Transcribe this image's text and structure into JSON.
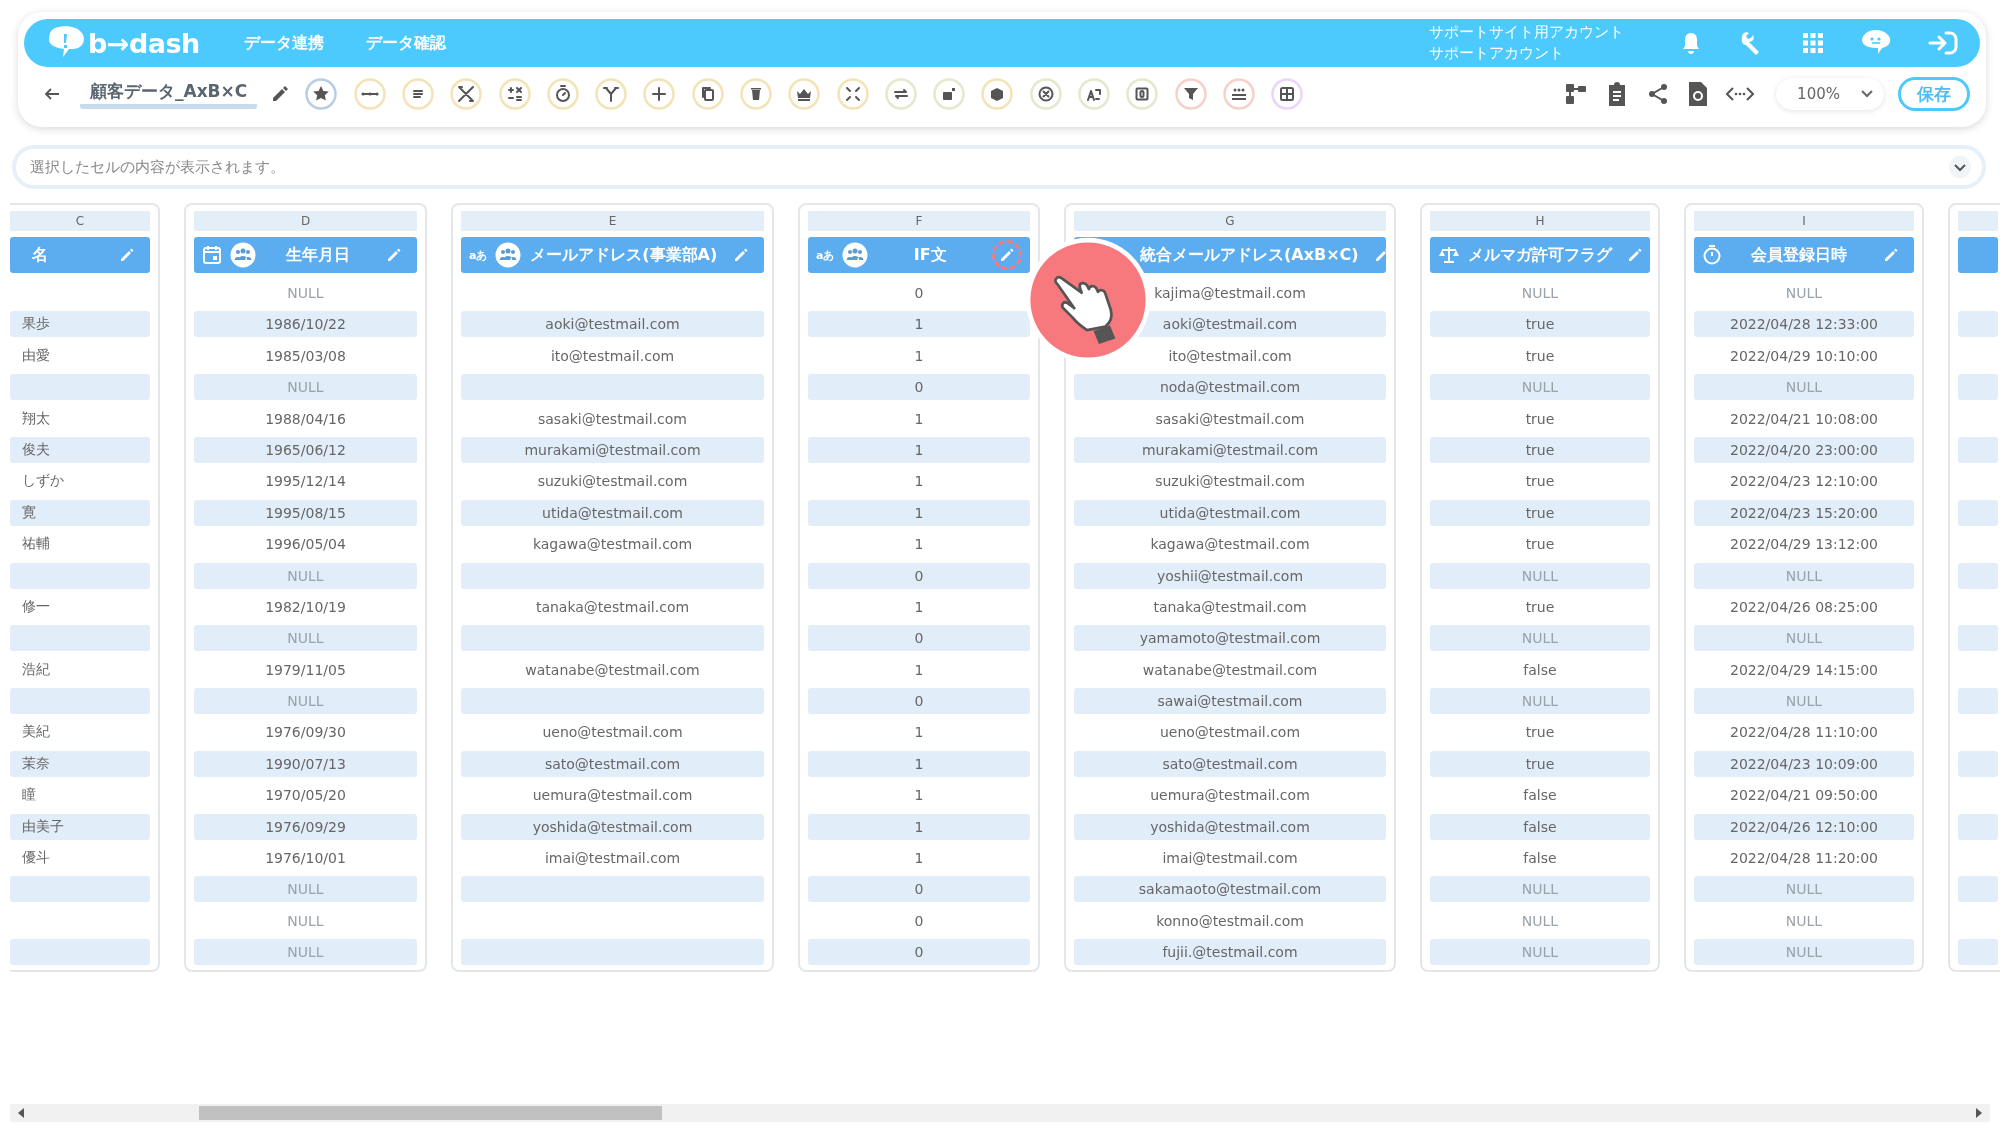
{
  "app_bar": {
    "logo": "b→dash",
    "nav": [
      {
        "label": "データ連携"
      },
      {
        "label": "データ確認"
      }
    ],
    "account": {
      "site": "サポートサイト用アカウント",
      "user": "サポートアカウント"
    }
  },
  "toolbar": {
    "title": "顧客データ_AxB×C",
    "tools": [
      {
        "kind": "star",
        "color": "#b9cde4"
      },
      {
        "kind": "join",
        "color": "#f4e3b6"
      },
      {
        "kind": "lines",
        "color": "#f4e3b6"
      },
      {
        "kind": "tools",
        "color": "#f4e3b6"
      },
      {
        "kind": "calc",
        "color": "#f4e3b6"
      },
      {
        "kind": "timer",
        "color": "#f4e3b6"
      },
      {
        "kind": "branch",
        "color": "#f4e3b6"
      },
      {
        "kind": "plus",
        "color": "#f4e3b6"
      },
      {
        "kind": "copy",
        "color": "#f4e3b6"
      },
      {
        "kind": "trash",
        "color": "#f4e3b6"
      },
      {
        "kind": "crown",
        "color": "#f4e3b6"
      },
      {
        "kind": "compress",
        "color": "#f4e3b6"
      },
      {
        "kind": "loop",
        "color": "#e3e9cc"
      },
      {
        "kind": "lock",
        "color": "#e3e9cc"
      },
      {
        "kind": "box",
        "color": "#f4e3b6"
      },
      {
        "kind": "cancel",
        "color": "#e3e9cc"
      },
      {
        "kind": "translate",
        "color": "#e3e9cc"
      },
      {
        "kind": "zero",
        "color": "#e3e9cc"
      },
      {
        "kind": "filter",
        "color": "#f9cfca"
      },
      {
        "kind": "group",
        "color": "#f9cfca"
      },
      {
        "kind": "grid",
        "color": "#ecd5f6"
      }
    ],
    "zoom": {
      "value": "100%"
    },
    "save_label": "保存"
  },
  "formula_bar": {
    "placeholder": "選択したセルの内容が表示されます。"
  },
  "columns": [
    {
      "letter": "C",
      "title": "名",
      "kind": "none",
      "shared": false,
      "highlighted": false,
      "cells": [
        null,
        "果歩",
        "由愛",
        null,
        "翔太",
        "俊夫",
        "しずか",
        "寛",
        "祐輔",
        null,
        "修一",
        null,
        "浩紀",
        null,
        "美紀",
        "茉奈",
        "瞳",
        "由美子",
        "優斗",
        null,
        null,
        null
      ]
    },
    {
      "letter": "D",
      "title": "生年月日",
      "kind": "date",
      "shared": true,
      "highlighted": false,
      "cells": [
        {
          "text": "NULL",
          "is_null": true
        },
        "1986/10/22",
        "1985/03/08",
        {
          "text": "NULL",
          "is_null": true
        },
        "1988/04/16",
        "1965/06/12",
        "1995/12/14",
        "1995/08/15",
        "1996/05/04",
        {
          "text": "NULL",
          "is_null": true
        },
        "1982/10/19",
        {
          "text": "NULL",
          "is_null": true
        },
        "1979/11/05",
        {
          "text": "NULL",
          "is_null": true
        },
        "1976/09/30",
        "1990/07/13",
        "1970/05/20",
        "1976/09/29",
        "1976/10/01",
        {
          "text": "NULL",
          "is_null": true
        },
        {
          "text": "NULL",
          "is_null": true
        },
        {
          "text": "NULL",
          "is_null": true
        }
      ]
    },
    {
      "letter": "E",
      "title": "メールアドレス(事業部A)",
      "kind": "text",
      "type_label": "aあ",
      "shared": true,
      "highlighted": false,
      "cells": [
        null,
        "aoki@testmail.com",
        "ito@testmail.com",
        null,
        "sasaki@testmail.com",
        "murakami@testmail.com",
        "suzuki@testmail.com",
        "utida@testmail.com",
        "kagawa@testmail.com",
        null,
        "tanaka@testmail.com",
        null,
        "watanabe@testmail.com",
        null,
        "ueno@testmail.com",
        "sato@testmail.com",
        "uemura@testmail.com",
        "yoshida@testmail.com",
        "imai@testmail.com",
        null,
        null,
        null
      ]
    },
    {
      "letter": "F",
      "title": "IF文",
      "kind": "text",
      "type_label": "aあ",
      "shared": true,
      "highlighted": true,
      "cells": [
        "0",
        "1",
        "1",
        "0",
        "1",
        "1",
        "1",
        "1",
        "1",
        "0",
        "1",
        "0",
        "1",
        "0",
        "1",
        "1",
        "1",
        "1",
        "1",
        "0",
        "0",
        "0"
      ]
    },
    {
      "letter": "G",
      "title": "統合メールアドレス(AxB×C)",
      "kind": "hidden",
      "shared": false,
      "highlighted": false,
      "cells": [
        "kajima@testmail.com",
        "aoki@testmail.com",
        "ito@testmail.com",
        "noda@testmail.com",
        "sasaki@testmail.com",
        "murakami@testmail.com",
        "suzuki@testmail.com",
        "utida@testmail.com",
        "kagawa@testmail.com",
        "yoshii@testmail.com",
        "tanaka@testmail.com",
        "yamamoto@testmail.com",
        "watanabe@testmail.com",
        "sawai@testmail.com",
        "ueno@testmail.com",
        "sato@testmail.com",
        "uemura@testmail.com",
        "yoshida@testmail.com",
        "imai@testmail.com",
        "sakamaoto@testmail.com",
        "konno@testmail.com",
        "fujii.@testmail.com"
      ]
    },
    {
      "letter": "H",
      "title": "メルマガ許可フラグ",
      "kind": "flag",
      "shared": false,
      "highlighted": false,
      "cells": [
        {
          "text": "NULL",
          "is_null": true
        },
        "true",
        "true",
        {
          "text": "NULL",
          "is_null": true
        },
        "true",
        "true",
        "true",
        "true",
        "true",
        {
          "text": "NULL",
          "is_null": true
        },
        "true",
        {
          "text": "NULL",
          "is_null": true
        },
        "false",
        {
          "text": "NULL",
          "is_null": true
        },
        "true",
        "true",
        "false",
        "false",
        "false",
        {
          "text": "NULL",
          "is_null": true
        },
        {
          "text": "NULL",
          "is_null": true
        },
        {
          "text": "NULL",
          "is_null": true
        }
      ]
    },
    {
      "letter": "I",
      "title": "会員登録日時",
      "kind": "datetime",
      "shared": false,
      "highlighted": false,
      "cells": [
        {
          "text": "NULL",
          "is_null": true
        },
        "2022/04/28 12:33:00",
        "2022/04/29 10:10:00",
        {
          "text": "NULL",
          "is_null": true
        },
        "2022/04/21 10:08:00",
        "2022/04/20 23:00:00",
        "2022/04/23 12:10:00",
        "2022/04/23 15:20:00",
        "2022/04/29 13:12:00",
        {
          "text": "NULL",
          "is_null": true
        },
        "2022/04/26 08:25:00",
        {
          "text": "NULL",
          "is_null": true
        },
        "2022/04/29 14:15:00",
        {
          "text": "NULL",
          "is_null": true
        },
        "2022/04/28 11:10:00",
        "2022/04/23 10:09:00",
        "2022/04/21 09:50:00",
        "2022/04/26 12:10:00",
        "2022/04/28 11:20:00",
        {
          "text": "NULL",
          "is_null": true
        },
        {
          "text": "NULL",
          "is_null": true
        },
        {
          "text": "NULL",
          "is_null": true
        }
      ]
    }
  ]
}
